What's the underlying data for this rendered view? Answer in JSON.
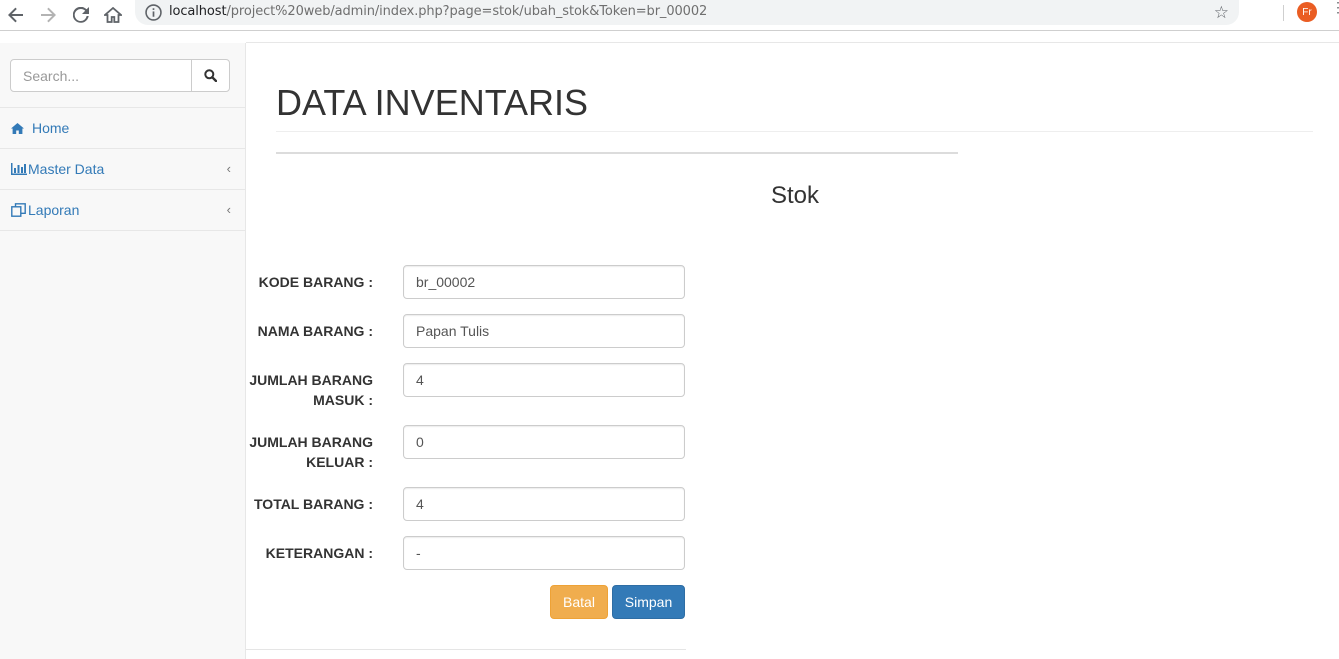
{
  "browser": {
    "url_host": "localhost",
    "url_path": "/project%20web/admin/index.php?page=stok/ubah_stok&Token=br_00002",
    "profile_initials": "Fr",
    "icons": [
      "back-icon",
      "forward-icon",
      "reload-icon",
      "home-icon",
      "info-icon",
      "star-icon",
      "menu-dots-icon"
    ]
  },
  "sidebar": {
    "search_placeholder": "Search...",
    "items": [
      {
        "label": "Home",
        "icon": "home-icon"
      },
      {
        "label": "Master Data",
        "icon": "bar-chart-icon",
        "chevron": "‹"
      },
      {
        "label": "Laporan",
        "icon": "copy-icon",
        "chevron": "‹"
      }
    ]
  },
  "page": {
    "title": "DATA INVENTARIS",
    "form_heading": "Stok"
  },
  "form": {
    "fields": [
      {
        "label": "KODE BARANG :",
        "value": "br_00002"
      },
      {
        "label": "NAMA BARANG :",
        "value": "Papan Tulis"
      },
      {
        "label_line1": "JUMLAH BARANG",
        "label_line2": "MASUK :",
        "value": "4"
      },
      {
        "label_line1": "JUMLAH BARANG",
        "label_line2": "KELUAR :",
        "value": "0"
      },
      {
        "label": "TOTAL BARANG :",
        "value": "4"
      },
      {
        "label": "KETERANGAN :",
        "value": "-"
      }
    ],
    "batal_label": "Batal",
    "simpan_label": "Simpan"
  },
  "colors": {
    "link": "#337ab7",
    "warning": "#f0ad4e",
    "primary": "#337ab7",
    "profile": "#ea5d23"
  }
}
